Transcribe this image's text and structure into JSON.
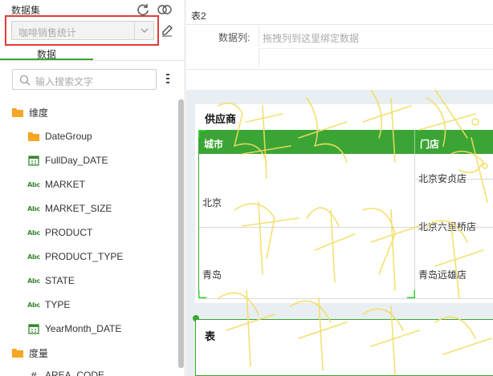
{
  "left_panel": {
    "header_label": "数据集",
    "dataset_select": {
      "value": "咖啡销售统计"
    },
    "tab_label": "数据",
    "search": {
      "placeholder": "输入搜索文字"
    },
    "tree": [
      {
        "kind": "folder",
        "label": "维度"
      },
      {
        "kind": "folder-child",
        "label": "DateGroup"
      },
      {
        "kind": "date",
        "label": "FullDay_DATE"
      },
      {
        "kind": "abc",
        "label": "MARKET"
      },
      {
        "kind": "abc",
        "label": "MARKET_SIZE"
      },
      {
        "kind": "abc",
        "label": "PRODUCT"
      },
      {
        "kind": "abc",
        "label": "PRODUCT_TYPE"
      },
      {
        "kind": "abc",
        "label": "STATE"
      },
      {
        "kind": "abc",
        "label": "TYPE"
      },
      {
        "kind": "date",
        "label": "YearMonth_DATE"
      },
      {
        "kind": "folder",
        "label": "度量"
      },
      {
        "kind": "hash",
        "label": "AREA_CODE"
      }
    ],
    "abc_glyph": "Abc",
    "hash_glyph": "#"
  },
  "right_panel": {
    "title": "表2",
    "data_column_label": "数据列:",
    "data_column_placeholder": "拖拽列到这里绑定数据",
    "card1": {
      "title": "供应商",
      "headers": [
        "城市",
        "门店"
      ],
      "rows": [
        {
          "city": "北京",
          "stores": [
            "北京安贞店",
            "北京六里桥店"
          ]
        },
        {
          "city": "青岛",
          "stores": [
            "青岛远雄店"
          ]
        }
      ]
    },
    "card2": {
      "title": "表"
    }
  },
  "colors": {
    "accent": "#3aa534",
    "highlight": "#e03b3b",
    "folder": "#f5a623",
    "watermark": "#f2dd62"
  }
}
